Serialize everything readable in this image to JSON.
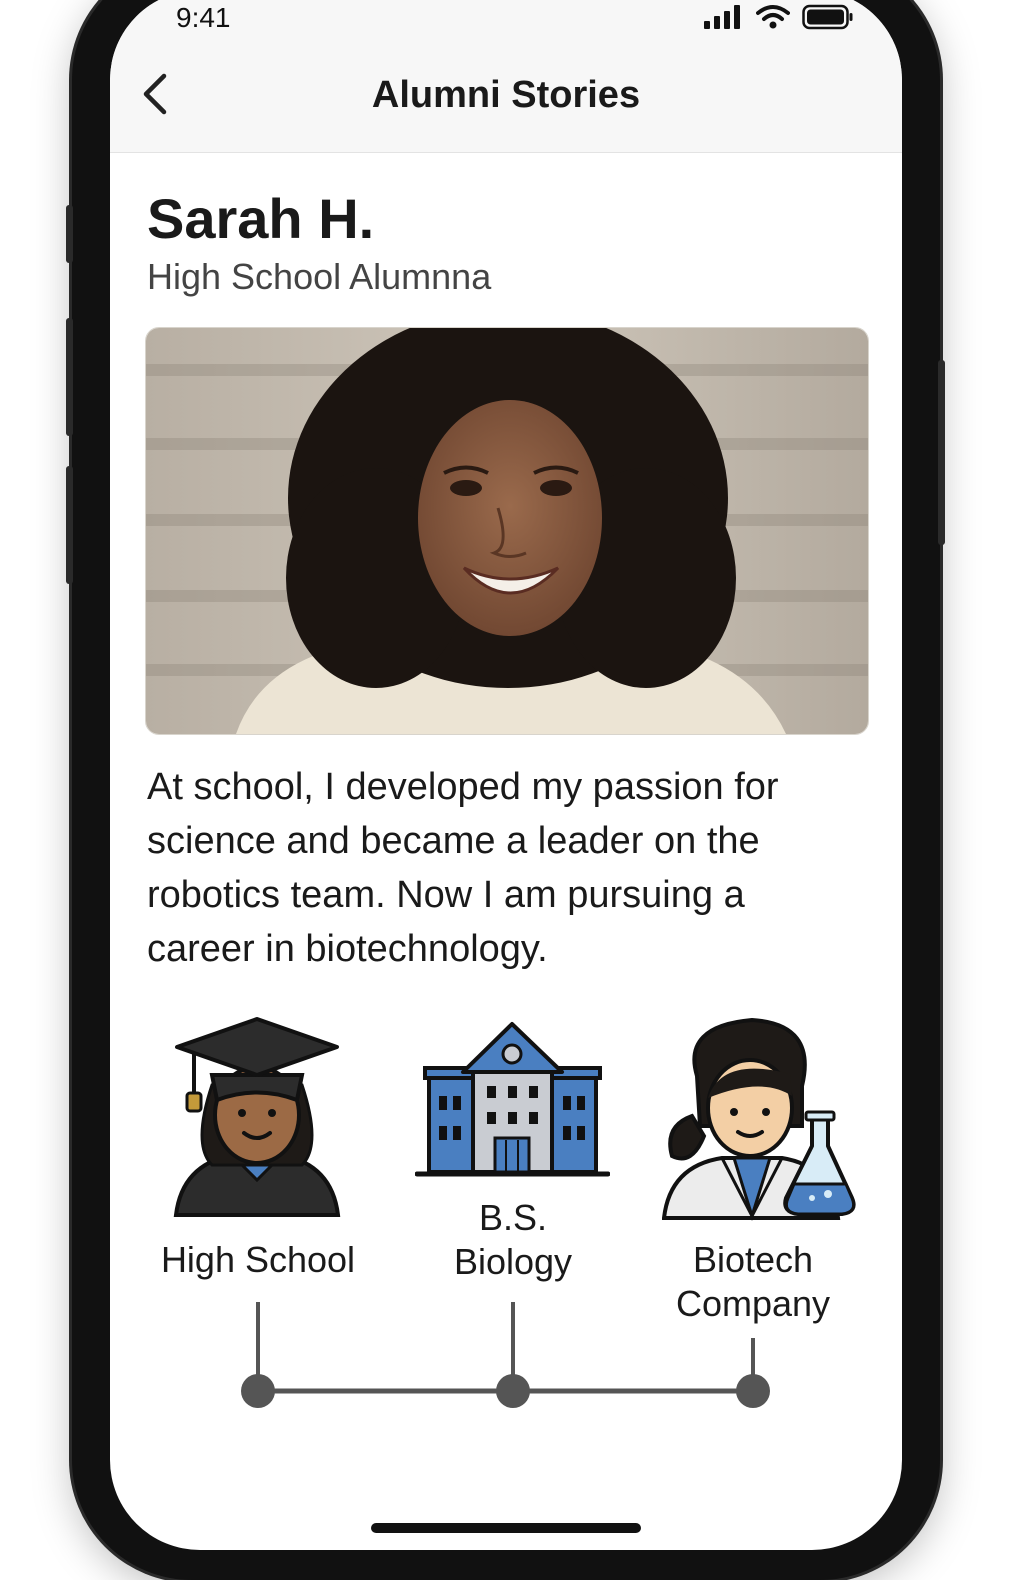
{
  "status_bar": {
    "time": "9:41",
    "icons": [
      "signal-icon",
      "wifi-icon",
      "battery-icon"
    ]
  },
  "nav": {
    "title": "Alumni Stories",
    "back_icon": "chevron-left-icon"
  },
  "profile": {
    "name": "Sarah H.",
    "role": "High School Alumnna",
    "photo": "portrait-photo"
  },
  "story": "At school, I developed my passion for science and became a leader on the robotics team. Now I am pursuing a career in biotechnology.",
  "timeline": {
    "items": [
      {
        "label_line1": "High School",
        "label_line2": "",
        "icon": "graduate-icon"
      },
      {
        "label_line1": "B.S.",
        "label_line2": "Biology",
        "icon": "university-building-icon"
      },
      {
        "label_line1": "Biotech",
        "label_line2": "Company",
        "icon": "scientist-icon"
      }
    ]
  },
  "colors": {
    "accent_blue": "#4a7fc1",
    "timeline_gray": "#555555",
    "nav_bg": "#f7f7f7"
  }
}
